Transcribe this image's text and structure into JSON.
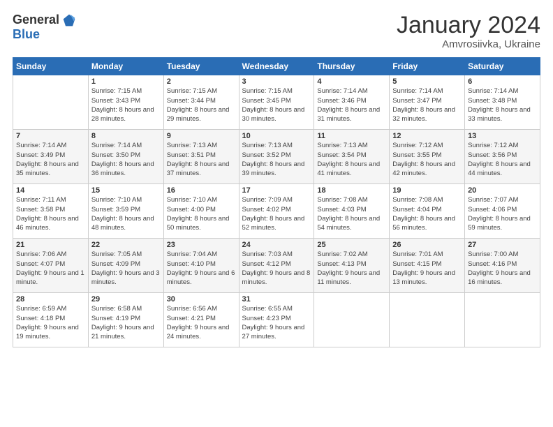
{
  "logo": {
    "general": "General",
    "blue": "Blue"
  },
  "header": {
    "title": "January 2024",
    "subtitle": "Amvrosiivka, Ukraine"
  },
  "days_of_week": [
    "Sunday",
    "Monday",
    "Tuesday",
    "Wednesday",
    "Thursday",
    "Friday",
    "Saturday"
  ],
  "weeks": [
    [
      {
        "day": "",
        "sunrise": "",
        "sunset": "",
        "daylight": ""
      },
      {
        "day": "1",
        "sunrise": "Sunrise: 7:15 AM",
        "sunset": "Sunset: 3:43 PM",
        "daylight": "Daylight: 8 hours and 28 minutes."
      },
      {
        "day": "2",
        "sunrise": "Sunrise: 7:15 AM",
        "sunset": "Sunset: 3:44 PM",
        "daylight": "Daylight: 8 hours and 29 minutes."
      },
      {
        "day": "3",
        "sunrise": "Sunrise: 7:15 AM",
        "sunset": "Sunset: 3:45 PM",
        "daylight": "Daylight: 8 hours and 30 minutes."
      },
      {
        "day": "4",
        "sunrise": "Sunrise: 7:14 AM",
        "sunset": "Sunset: 3:46 PM",
        "daylight": "Daylight: 8 hours and 31 minutes."
      },
      {
        "day": "5",
        "sunrise": "Sunrise: 7:14 AM",
        "sunset": "Sunset: 3:47 PM",
        "daylight": "Daylight: 8 hours and 32 minutes."
      },
      {
        "day": "6",
        "sunrise": "Sunrise: 7:14 AM",
        "sunset": "Sunset: 3:48 PM",
        "daylight": "Daylight: 8 hours and 33 minutes."
      }
    ],
    [
      {
        "day": "7",
        "sunrise": "Sunrise: 7:14 AM",
        "sunset": "Sunset: 3:49 PM",
        "daylight": "Daylight: 8 hours and 35 minutes."
      },
      {
        "day": "8",
        "sunrise": "Sunrise: 7:14 AM",
        "sunset": "Sunset: 3:50 PM",
        "daylight": "Daylight: 8 hours and 36 minutes."
      },
      {
        "day": "9",
        "sunrise": "Sunrise: 7:13 AM",
        "sunset": "Sunset: 3:51 PM",
        "daylight": "Daylight: 8 hours and 37 minutes."
      },
      {
        "day": "10",
        "sunrise": "Sunrise: 7:13 AM",
        "sunset": "Sunset: 3:52 PM",
        "daylight": "Daylight: 8 hours and 39 minutes."
      },
      {
        "day": "11",
        "sunrise": "Sunrise: 7:13 AM",
        "sunset": "Sunset: 3:54 PM",
        "daylight": "Daylight: 8 hours and 41 minutes."
      },
      {
        "day": "12",
        "sunrise": "Sunrise: 7:12 AM",
        "sunset": "Sunset: 3:55 PM",
        "daylight": "Daylight: 8 hours and 42 minutes."
      },
      {
        "day": "13",
        "sunrise": "Sunrise: 7:12 AM",
        "sunset": "Sunset: 3:56 PM",
        "daylight": "Daylight: 8 hours and 44 minutes."
      }
    ],
    [
      {
        "day": "14",
        "sunrise": "Sunrise: 7:11 AM",
        "sunset": "Sunset: 3:58 PM",
        "daylight": "Daylight: 8 hours and 46 minutes."
      },
      {
        "day": "15",
        "sunrise": "Sunrise: 7:10 AM",
        "sunset": "Sunset: 3:59 PM",
        "daylight": "Daylight: 8 hours and 48 minutes."
      },
      {
        "day": "16",
        "sunrise": "Sunrise: 7:10 AM",
        "sunset": "Sunset: 4:00 PM",
        "daylight": "Daylight: 8 hours and 50 minutes."
      },
      {
        "day": "17",
        "sunrise": "Sunrise: 7:09 AM",
        "sunset": "Sunset: 4:02 PM",
        "daylight": "Daylight: 8 hours and 52 minutes."
      },
      {
        "day": "18",
        "sunrise": "Sunrise: 7:08 AM",
        "sunset": "Sunset: 4:03 PM",
        "daylight": "Daylight: 8 hours and 54 minutes."
      },
      {
        "day": "19",
        "sunrise": "Sunrise: 7:08 AM",
        "sunset": "Sunset: 4:04 PM",
        "daylight": "Daylight: 8 hours and 56 minutes."
      },
      {
        "day": "20",
        "sunrise": "Sunrise: 7:07 AM",
        "sunset": "Sunset: 4:06 PM",
        "daylight": "Daylight: 8 hours and 59 minutes."
      }
    ],
    [
      {
        "day": "21",
        "sunrise": "Sunrise: 7:06 AM",
        "sunset": "Sunset: 4:07 PM",
        "daylight": "Daylight: 9 hours and 1 minute."
      },
      {
        "day": "22",
        "sunrise": "Sunrise: 7:05 AM",
        "sunset": "Sunset: 4:09 PM",
        "daylight": "Daylight: 9 hours and 3 minutes."
      },
      {
        "day": "23",
        "sunrise": "Sunrise: 7:04 AM",
        "sunset": "Sunset: 4:10 PM",
        "daylight": "Daylight: 9 hours and 6 minutes."
      },
      {
        "day": "24",
        "sunrise": "Sunrise: 7:03 AM",
        "sunset": "Sunset: 4:12 PM",
        "daylight": "Daylight: 9 hours and 8 minutes."
      },
      {
        "day": "25",
        "sunrise": "Sunrise: 7:02 AM",
        "sunset": "Sunset: 4:13 PM",
        "daylight": "Daylight: 9 hours and 11 minutes."
      },
      {
        "day": "26",
        "sunrise": "Sunrise: 7:01 AM",
        "sunset": "Sunset: 4:15 PM",
        "daylight": "Daylight: 9 hours and 13 minutes."
      },
      {
        "day": "27",
        "sunrise": "Sunrise: 7:00 AM",
        "sunset": "Sunset: 4:16 PM",
        "daylight": "Daylight: 9 hours and 16 minutes."
      }
    ],
    [
      {
        "day": "28",
        "sunrise": "Sunrise: 6:59 AM",
        "sunset": "Sunset: 4:18 PM",
        "daylight": "Daylight: 9 hours and 19 minutes."
      },
      {
        "day": "29",
        "sunrise": "Sunrise: 6:58 AM",
        "sunset": "Sunset: 4:19 PM",
        "daylight": "Daylight: 9 hours and 21 minutes."
      },
      {
        "day": "30",
        "sunrise": "Sunrise: 6:56 AM",
        "sunset": "Sunset: 4:21 PM",
        "daylight": "Daylight: 9 hours and 24 minutes."
      },
      {
        "day": "31",
        "sunrise": "Sunrise: 6:55 AM",
        "sunset": "Sunset: 4:23 PM",
        "daylight": "Daylight: 9 hours and 27 minutes."
      },
      {
        "day": "",
        "sunrise": "",
        "sunset": "",
        "daylight": ""
      },
      {
        "day": "",
        "sunrise": "",
        "sunset": "",
        "daylight": ""
      },
      {
        "day": "",
        "sunrise": "",
        "sunset": "",
        "daylight": ""
      }
    ]
  ]
}
